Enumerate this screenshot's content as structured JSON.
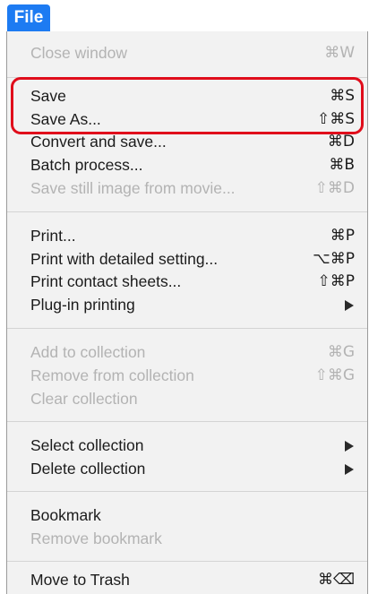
{
  "menu": {
    "title": "File",
    "items": [
      {
        "label": "Close window",
        "shortcut": "⌘W"
      },
      {
        "label": "Save",
        "shortcut": "⌘S"
      },
      {
        "label": "Save As...",
        "shortcut": "⇧⌘S"
      },
      {
        "label": "Convert and save...",
        "shortcut": "⌘D"
      },
      {
        "label": "Batch process...",
        "shortcut": "⌘B"
      },
      {
        "label": "Save still image from movie...",
        "shortcut": "⇧⌘D"
      },
      {
        "label": "Print...",
        "shortcut": "⌘P"
      },
      {
        "label": "Print with detailed setting...",
        "shortcut": "⌥⌘P"
      },
      {
        "label": "Print contact sheets...",
        "shortcut": "⇧⌘P"
      },
      {
        "label": "Plug-in printing",
        "submenu_icon": "chevron-right-icon"
      },
      {
        "label": "Add to collection",
        "shortcut": "⌘G"
      },
      {
        "label": "Remove from collection",
        "shortcut": "⇧⌘G"
      },
      {
        "label": "Clear collection"
      },
      {
        "label": "Select collection",
        "submenu_icon": "chevron-right-icon"
      },
      {
        "label": "Delete collection",
        "submenu_icon": "chevron-right-icon"
      },
      {
        "label": "Bookmark"
      },
      {
        "label": "Remove bookmark"
      },
      {
        "label": "Move to Trash",
        "shortcut": "⌘⌫"
      }
    ]
  },
  "colors": {
    "menu_title_bg": "#1d7bf2",
    "highlight_border": "#e00d1b",
    "disabled_text": "#b3b3b3",
    "enabled_text": "#1b1b1b"
  }
}
